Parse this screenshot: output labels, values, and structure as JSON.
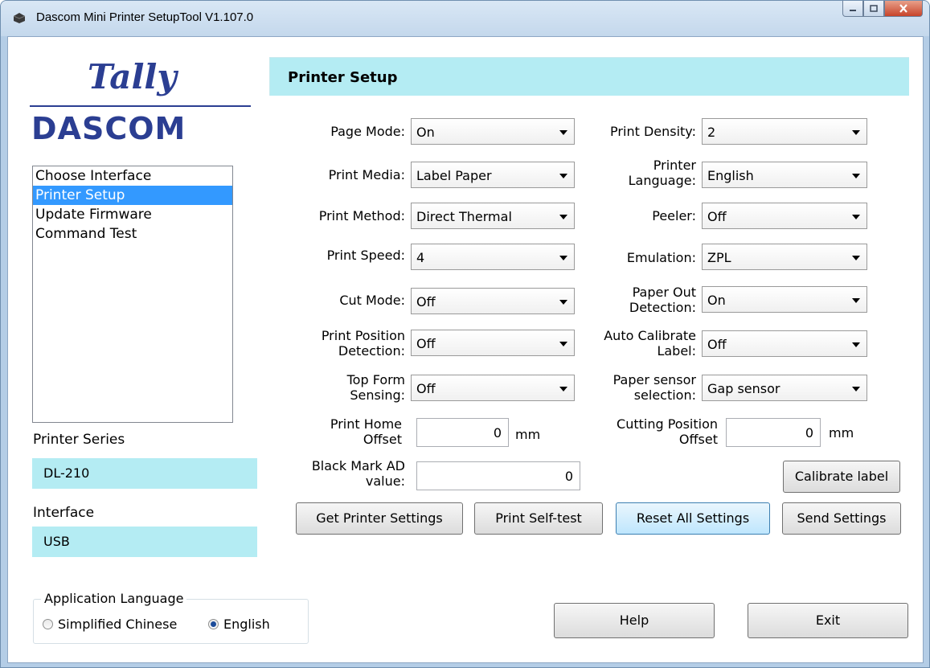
{
  "window": {
    "title": "Dascom Mini Printer SetupTool V1.107.0"
  },
  "logo": {
    "tally": "Tally",
    "dascom": "DASCOM"
  },
  "nav": {
    "items": [
      {
        "label": "Choose Interface",
        "selected": false
      },
      {
        "label": "Printer Setup",
        "selected": true
      },
      {
        "label": "Update Firmware",
        "selected": false
      },
      {
        "label": "Command Test",
        "selected": false
      }
    ]
  },
  "printer_series": {
    "label": "Printer Series",
    "value": "DL-210"
  },
  "interface": {
    "label": "Interface",
    "value": "USB"
  },
  "app_language": {
    "title": "Application Language",
    "options": [
      "Simplified Chinese",
      "English"
    ],
    "selected": "English"
  },
  "panel": {
    "title": "Printer Setup"
  },
  "settings": {
    "page_mode": {
      "label": "Page Mode:",
      "value": "On"
    },
    "print_media": {
      "label": "Print Media:",
      "value": "Label Paper"
    },
    "print_method": {
      "label": "Print Method:",
      "value": "Direct Thermal"
    },
    "print_speed": {
      "label": "Print Speed:",
      "value": "4"
    },
    "cut_mode": {
      "label": "Cut Mode:",
      "value": "Off"
    },
    "print_position_detection": {
      "label1": "Print Position",
      "label2": "Detection:",
      "value": "Off"
    },
    "top_form_sensing": {
      "label1": "Top Form",
      "label2": "Sensing:",
      "value": "Off"
    },
    "print_density": {
      "label": "Print Density:",
      "value": "2"
    },
    "printer_language": {
      "label1": "Printer",
      "label2": "Language:",
      "value": "English"
    },
    "peeler": {
      "label": "Peeler:",
      "value": "Off"
    },
    "emulation": {
      "label": "Emulation:",
      "value": "ZPL"
    },
    "paper_out_detection": {
      "label1": "Paper Out",
      "label2": "Detection:",
      "value": "On"
    },
    "auto_calibrate_label": {
      "label1": "Auto Calibrate",
      "label2": "Label:",
      "value": "Off"
    },
    "paper_sensor_selection": {
      "label1": "Paper sensor",
      "label2": "selection:",
      "value": "Gap sensor"
    },
    "print_home_offset": {
      "label1": "Print Home",
      "label2": "Offset",
      "value": "0",
      "unit": "mm"
    },
    "cutting_position_offset": {
      "label1": "Cutting Position",
      "label2": "Offset",
      "value": "0",
      "unit": "mm"
    },
    "black_mark_ad": {
      "label1": "Black Mark AD",
      "label2": "value:",
      "value": "0"
    }
  },
  "buttons": {
    "calibrate": "Calibrate label",
    "get_settings": "Get Printer Settings",
    "self_test": "Print Self-test",
    "reset_all": "Reset All Settings",
    "send_settings": "Send Settings",
    "help": "Help",
    "exit": "Exit"
  }
}
